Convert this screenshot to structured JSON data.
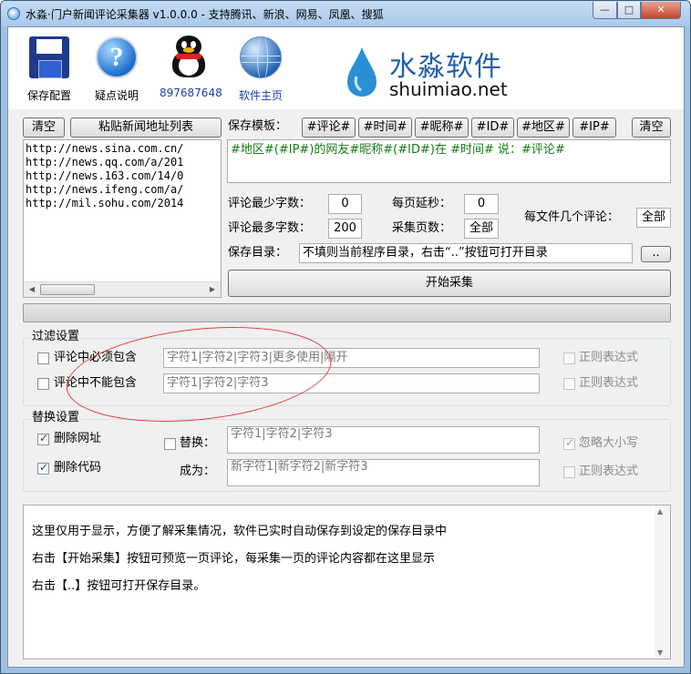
{
  "window": {
    "title": "水淼·门户新闻评论采集器 v1.0.0.0 - 支持腾讯、新浪、网易、凤凰、搜狐",
    "min_glyph": "—",
    "max_glyph": "□",
    "close_glyph": "✕"
  },
  "toolbar": {
    "save_config": "保存配置",
    "faq": "疑点说明",
    "qq_number": "897687648",
    "homepage": "软件主页",
    "help_glyph": "?"
  },
  "brand": {
    "name_cn": "水淼软件",
    "name_en": "shuimiao.net",
    "drop_color": "#2a8fd6"
  },
  "urls": {
    "clear_label": "清空",
    "paste_label": "粘贴新闻地址列表",
    "lines": [
      "http://news.sina.com.cn/",
      "http://news.qq.com/a/201",
      "http://news.163.com/14/0",
      "http://news.ifeng.com/a/",
      "http://mil.sohu.com/2014"
    ],
    "scroll_left": "◀",
    "scroll_right": "▶"
  },
  "template": {
    "label": "保存模板：",
    "tags": [
      "#评论#",
      "#时间#",
      "#昵称#",
      "#ID#",
      "#地区#",
      "#IP#"
    ],
    "clear_label": "清空",
    "value": "#地区#(#IP#)的网友#昵称#(#ID#)在 #时间# 说：#评论#"
  },
  "settings": {
    "min_chars_label": "评论最少字数：",
    "min_chars": "0",
    "max_chars_label": "评论最多字数：",
    "max_chars": "200",
    "delay_label": "每页延秒：",
    "delay": "0",
    "pages_label": "采集页数：",
    "pages": "全部",
    "per_file_label": "每文件几个评论：",
    "per_file": "全部",
    "save_dir_label": "保存目录：",
    "save_dir": "不填则当前程序目录，右击“..”按钮可打开目录",
    "browse_label": "..",
    "start_label": "开始采集"
  },
  "filter": {
    "title": "过滤设置",
    "must_contain_label": "评论中必须包含",
    "must_contain_value": "字符1|字符2|字符3|更多使用|隔开",
    "must_contain_regex": "正则表达式",
    "must_not_contain_label": "评论中不能包含",
    "must_not_contain_value": "字符1|字符2|字符3",
    "must_not_contain_regex": "正则表达式"
  },
  "replace": {
    "title": "替换设置",
    "remove_url_label": "删除网址",
    "remove_url_checked": true,
    "remove_code_label": "删除代码",
    "remove_code_checked": true,
    "replace_label": "替换：",
    "replace_value": "字符1|字符2|字符3",
    "become_label": "成为：",
    "become_value": "新字符1|新字符2|新字符3",
    "ignore_case_label": "忽略大小写",
    "ignore_case_checked": true,
    "regex_label": "正则表达式"
  },
  "log": {
    "lines": [
      "这里仅用于显示，方便了解采集情况，软件已实时自动保存到设定的保存目录中",
      "右击【开始采集】按钮可预览一页评论，每采集一页的评论内容都在这里显示",
      "右击【..】按钮可打开保存目录。"
    ],
    "scroll_up": "▲",
    "scroll_down": "▼"
  },
  "colors": {
    "template_text": "#177a17",
    "brand_text": "#1f5faf",
    "annotation": "#e23c3c"
  }
}
